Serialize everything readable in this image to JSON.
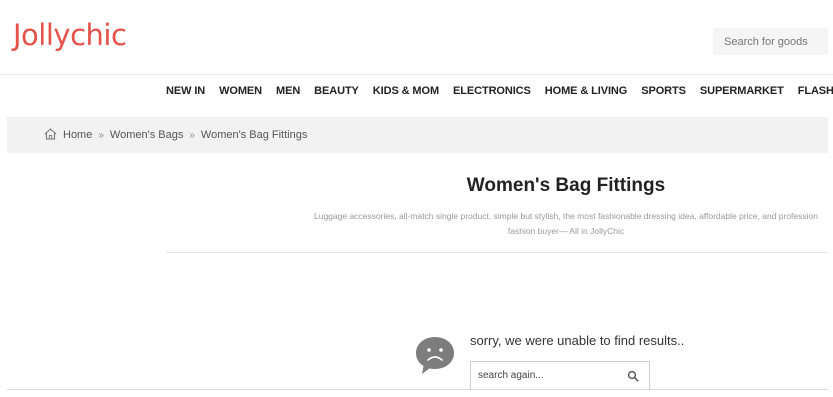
{
  "header": {
    "logo_text": "Jollychic",
    "search_placeholder": "Search for goods",
    "brand_color": "#e5524a"
  },
  "nav": {
    "items": [
      {
        "label": "NEW IN"
      },
      {
        "label": "WOMEN"
      },
      {
        "label": "MEN"
      },
      {
        "label": "BEAUTY"
      },
      {
        "label": "KIDS & MOM"
      },
      {
        "label": "ELECTRONICS"
      },
      {
        "label": "HOME & LIVING"
      },
      {
        "label": "SPORTS"
      },
      {
        "label": "SUPERMARKET"
      },
      {
        "label": "FLASH SALE"
      }
    ]
  },
  "breadcrumb": {
    "icon": "home-icon",
    "items": [
      {
        "label": "Home"
      },
      {
        "label": "Women's Bags"
      },
      {
        "label": "Women's Bag Fittings"
      }
    ],
    "separator": "»"
  },
  "category": {
    "title": "Women's Bag Fittings",
    "description_line1": "Luggage accessories, all-match single product, simple but stylish, the most fashionable dressing idea, affordable price, and profession",
    "description_line2": "fashion buyer— All in JollyChic"
  },
  "empty_state": {
    "icon": "sad-face-chat-icon",
    "message": "sorry, we were unable to find results..",
    "search_again_placeholder": "search again...",
    "search_button_icon": "search-icon"
  }
}
